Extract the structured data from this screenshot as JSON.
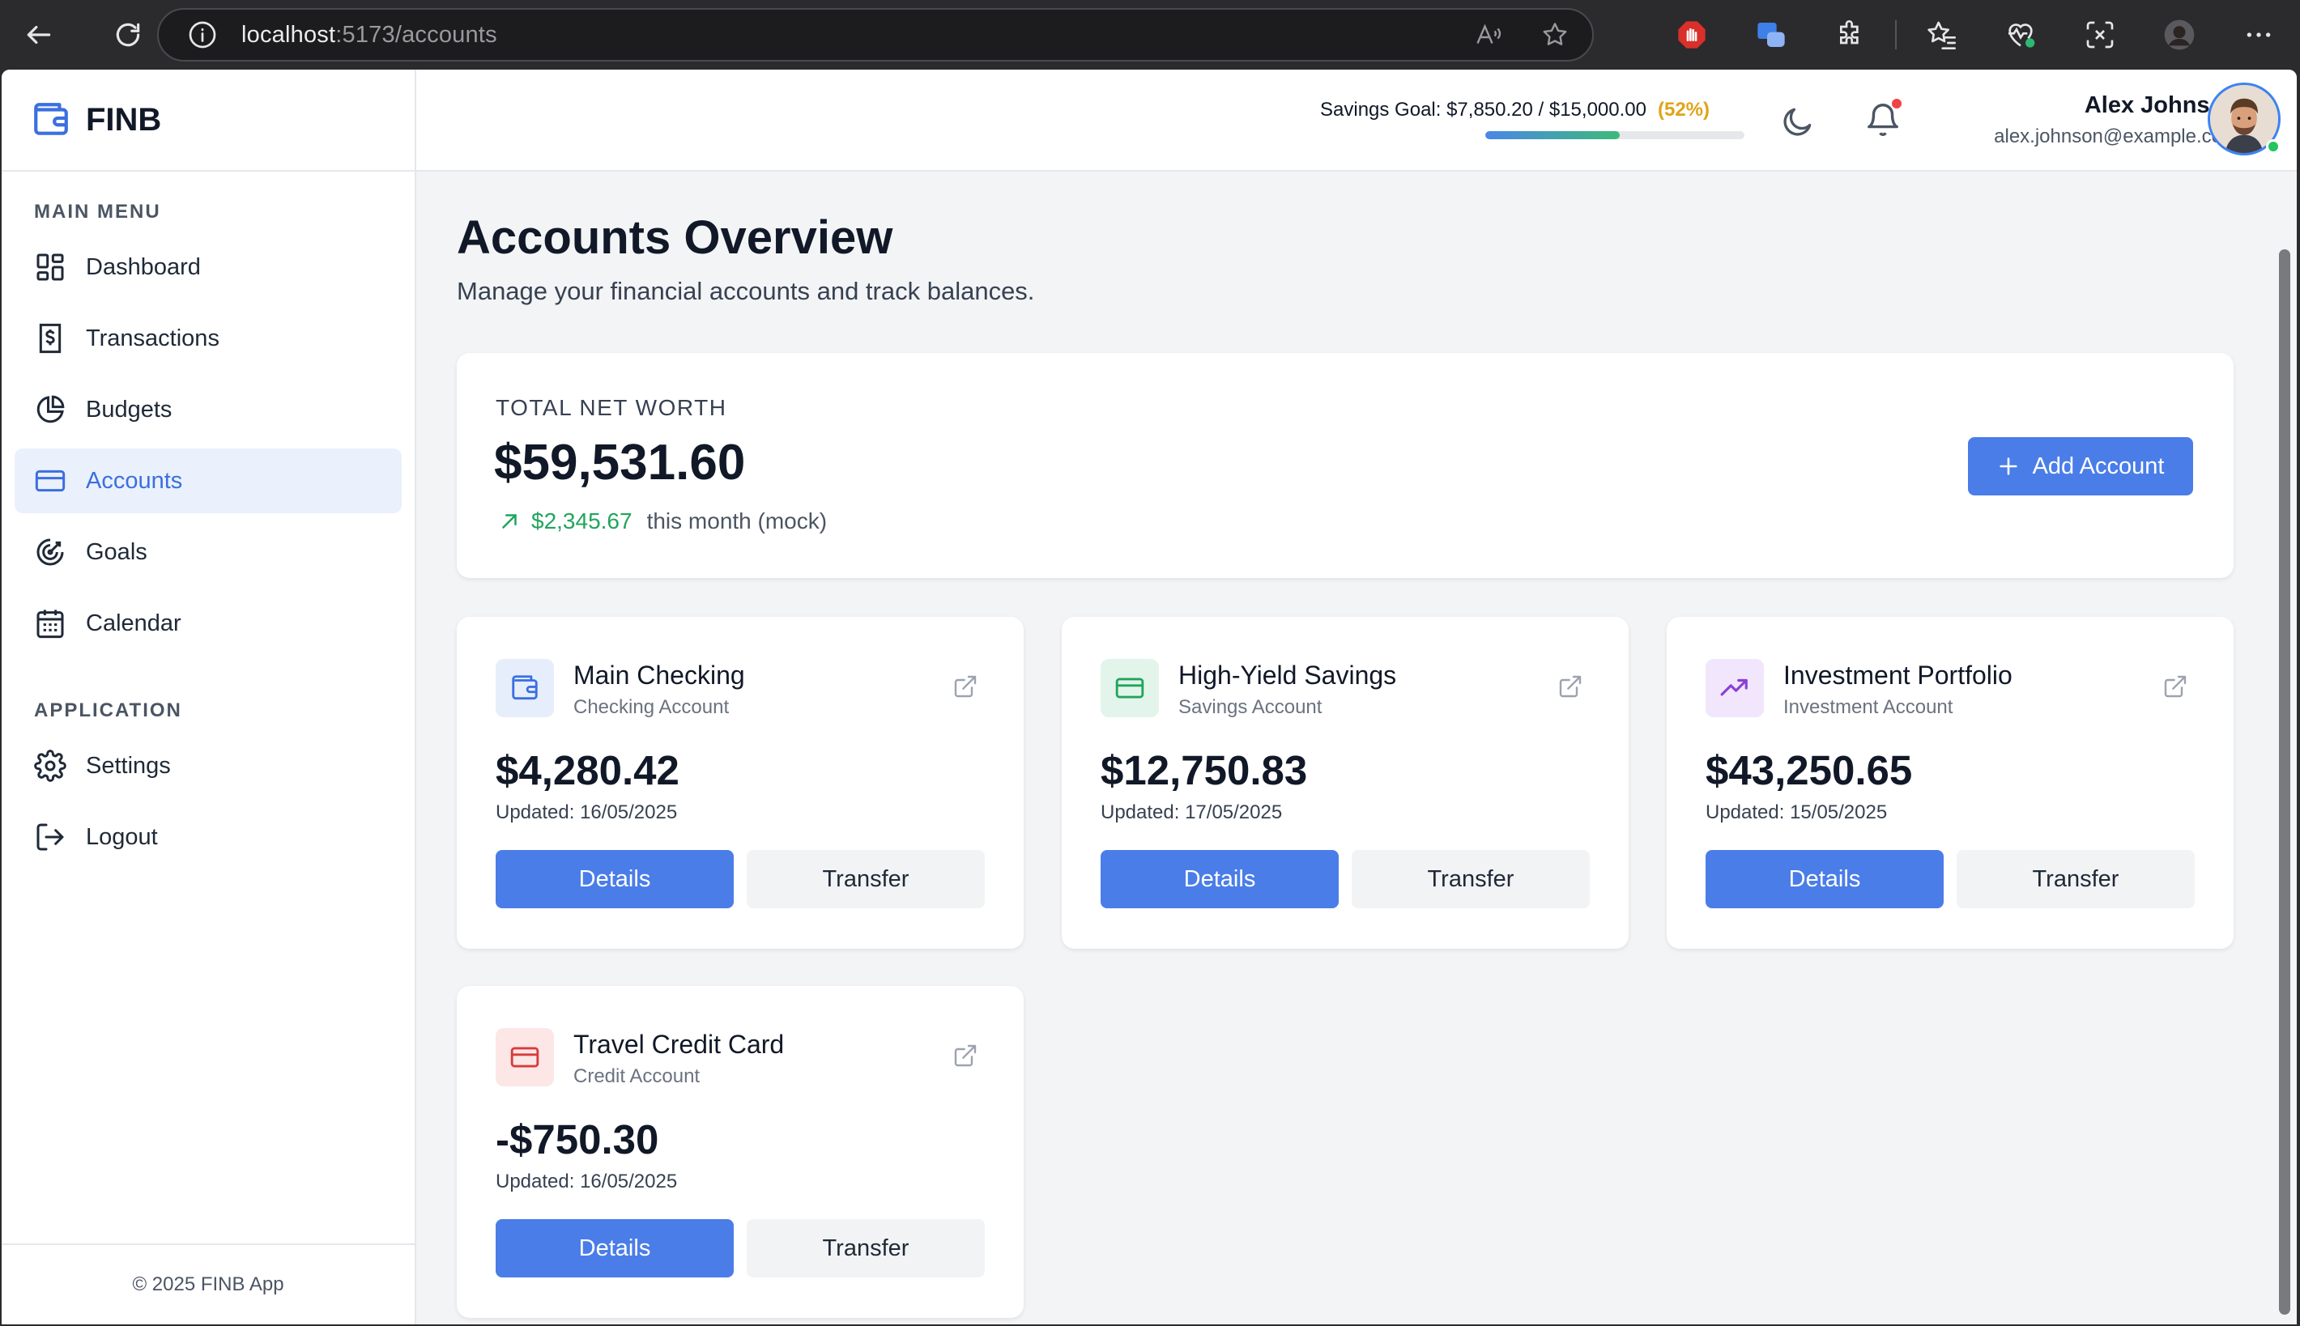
{
  "browser": {
    "url_host": "localhost",
    "url_path": ":5173/accounts"
  },
  "app": {
    "brand": "FINB",
    "footer": "© 2025 FINB App"
  },
  "sidebar": {
    "main_menu_title": "MAIN MENU",
    "application_title": "APPLICATION",
    "main_items": [
      {
        "label": "Dashboard",
        "icon": "dashboard-icon"
      },
      {
        "label": "Transactions",
        "icon": "receipt-dollar-icon"
      },
      {
        "label": "Budgets",
        "icon": "pie-chart-icon"
      },
      {
        "label": "Accounts",
        "icon": "credit-card-icon",
        "active": true
      },
      {
        "label": "Goals",
        "icon": "target-icon"
      },
      {
        "label": "Calendar",
        "icon": "calendar-icon"
      }
    ],
    "app_items": [
      {
        "label": "Settings",
        "icon": "gear-icon"
      },
      {
        "label": "Logout",
        "icon": "logout-icon"
      }
    ]
  },
  "topbar": {
    "savings_label": "Savings Goal: $7,850.20 / $15,000.00",
    "savings_pct_label": "(52%)",
    "savings_progress": 0.52,
    "user_name": "Alex Johnson",
    "user_email": "alex.johnson@example.com"
  },
  "page": {
    "title": "Accounts Overview",
    "subtitle": "Manage your financial accounts and track balances."
  },
  "networth": {
    "label": "TOTAL NET WORTH",
    "total": "$59,531.60",
    "change_amount": "$2,345.67",
    "change_note": "this month (mock)",
    "add_button": "Add Account"
  },
  "accounts": [
    {
      "name": "Main Checking",
      "type": "Checking Account",
      "balance": "$4,280.42",
      "updated": "Updated: 16/05/2025",
      "icon": "wallet-icon",
      "color": "#3b6fe0",
      "bg": "#e6eefc"
    },
    {
      "name": "High-Yield Savings",
      "type": "Savings Account",
      "balance": "$12,750.83",
      "updated": "Updated: 17/05/2025",
      "icon": "card-icon",
      "color": "#22a45d",
      "bg": "#e3f5ea"
    },
    {
      "name": "Investment Portfolio",
      "type": "Investment Account",
      "balance": "$43,250.65",
      "updated": "Updated: 15/05/2025",
      "icon": "trending-up-icon",
      "color": "#8b3fd9",
      "bg": "#f1e6fb"
    },
    {
      "name": "Travel Credit Card",
      "type": "Credit Account",
      "balance": "-$750.30",
      "updated": "Updated: 16/05/2025",
      "icon": "card-icon",
      "color": "#d93b3b",
      "bg": "#fce6e6"
    }
  ],
  "buttons": {
    "details": "Details",
    "transfer": "Transfer"
  },
  "colors": {
    "accent": "#4a7de8",
    "positive": "#22a45d",
    "warning": "#e0a419"
  }
}
